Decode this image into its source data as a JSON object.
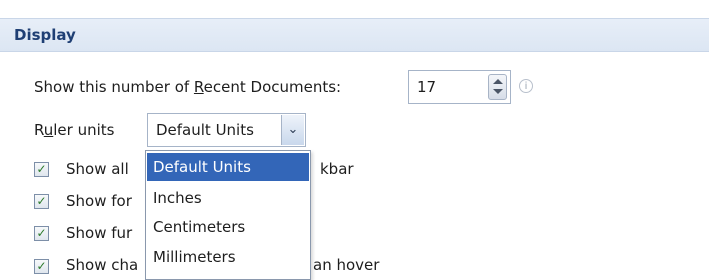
{
  "section": {
    "title": "Display"
  },
  "recent_docs": {
    "label_pre": "Show this number of ",
    "label_key": "R",
    "label_post": "ecent Documents:",
    "value": "17",
    "info_glyph": "i"
  },
  "ruler": {
    "label_pre": "R",
    "label_key": "u",
    "label_post": "ler units",
    "selected": "Default Units",
    "options": [
      "Default Units",
      "Inches",
      "Centimeters",
      "Millimeters"
    ]
  },
  "checkboxes": [
    {
      "text_left": "Show all",
      "text_right": "kbar",
      "checked": true
    },
    {
      "text_left": "Show for",
      "text_right": "",
      "checked": true
    },
    {
      "text_left": "Show fur",
      "text_right": "",
      "checked": true
    },
    {
      "text_left": "Show cha",
      "text_right": "an hover",
      "checked": true
    }
  ],
  "colors": {
    "header_text": "#1f3f74",
    "selection": "#3366b8",
    "check": "#2b7a2b"
  }
}
